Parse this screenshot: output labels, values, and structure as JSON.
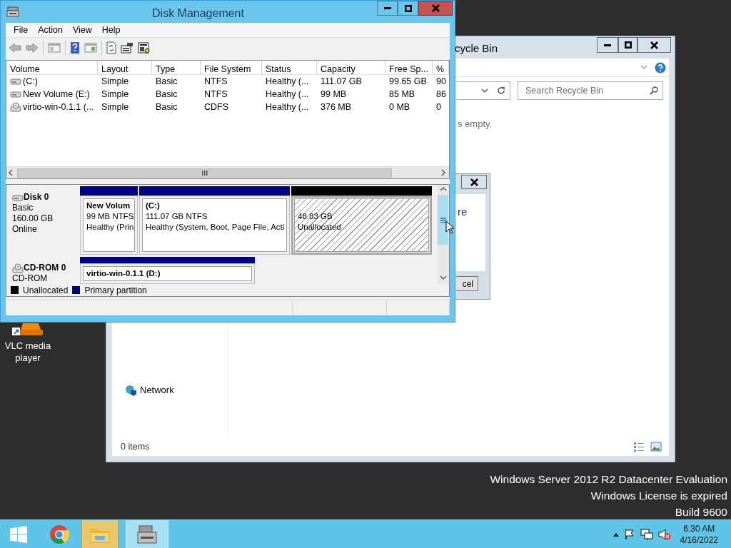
{
  "disk_management": {
    "title": "Disk Management",
    "menu": [
      "File",
      "Action",
      "View",
      "Help"
    ],
    "columns": [
      "Volume",
      "Layout",
      "Type",
      "File System",
      "Status",
      "Capacity",
      "Free Sp...",
      "%"
    ],
    "volumes": [
      {
        "kind": "disk",
        "cells": [
          "(C:)",
          "Simple",
          "Basic",
          "NTFS",
          "Healthy (...",
          "111.07 GB",
          "99.65 GB",
          "90"
        ]
      },
      {
        "kind": "disk",
        "cells": [
          "New Volume (E:)",
          "Simple",
          "Basic",
          "NTFS",
          "Healthy (...",
          "99 MB",
          "85 MB",
          "86"
        ]
      },
      {
        "kind": "cd",
        "cells": [
          "virtio-win-0.1.1 (...",
          "Simple",
          "Basic",
          "CDFS",
          "Healthy (...",
          "376 MB",
          "0 MB",
          "0"
        ]
      }
    ],
    "disks": [
      {
        "kind": "disk",
        "name": "Disk 0",
        "lines": [
          "Basic",
          "160.00 GB",
          "Online"
        ],
        "partitions": [
          {
            "kind": "primary",
            "selected": false,
            "name": "New Volum",
            "lines": [
              "99 MB NTFS",
              "Healthy (Prin"
            ]
          },
          {
            "kind": "primary",
            "selected": false,
            "name": "(C:)",
            "lines": [
              "111.07 GB NTFS",
              "Healthy (System, Boot, Page File, Acti"
            ]
          },
          {
            "kind": "unallocated",
            "selected": true,
            "lines": [
              "48.83 GB",
              "Unallocated"
            ]
          }
        ]
      },
      {
        "kind": "cd",
        "name": "CD-ROM 0",
        "lines": [
          "CD-ROM"
        ],
        "partitions": [
          {
            "kind": "primary",
            "selected": false,
            "name": "virtio-win-0.1.1 (D:)"
          }
        ]
      }
    ],
    "legend": [
      {
        "label": "Unallocated",
        "color": "#000000"
      },
      {
        "label": "Primary partition",
        "color": "#000080"
      }
    ]
  },
  "recycle_bin": {
    "title": "cycle Bin",
    "search_placeholder": "Search Recycle Bin",
    "message": "s empty.",
    "nav": [
      {
        "label": "Network"
      }
    ],
    "status": "0 items"
  },
  "dialog": {
    "text": "re",
    "button": "cel"
  },
  "desktop_icons": [
    {
      "label": "VLC media player"
    }
  ],
  "watermark": [
    "Windows Server 2012 R2 Datacenter Evaluation",
    "Windows License is expired",
    "Build 9600"
  ],
  "taskbar": {
    "apps": [
      {
        "kind": "start",
        "running": false,
        "selected": false
      },
      {
        "kind": "chrome",
        "running": false,
        "selected": false
      },
      {
        "kind": "explorer",
        "running": true,
        "selected": false
      },
      {
        "kind": "diskmgmt",
        "running": true,
        "selected": true
      }
    ],
    "tray": {
      "muted": true
    },
    "clock": {
      "time": "6:30 AM",
      "date": "4/16/2022"
    }
  }
}
